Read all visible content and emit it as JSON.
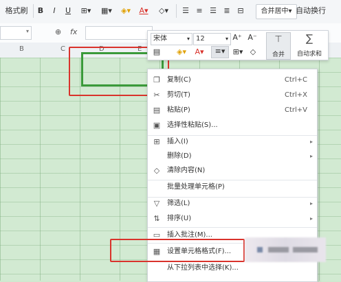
{
  "toolbar": {
    "format_painter": "格式刷",
    "bold": "B",
    "italic": "I",
    "underline": "U",
    "merge_center": "合并居中",
    "wrap_text": "自动换行"
  },
  "formula_bar": {
    "fx": "fx"
  },
  "columns": [
    "B",
    "C",
    "D",
    "E"
  ],
  "mini_toolbar": {
    "font_name": "宋体",
    "font_size": "12",
    "grow_font": "A⁺",
    "shrink_font": "A⁻",
    "merge_label": "合并",
    "autosum_label": "自动求和"
  },
  "context_menu": {
    "items": [
      {
        "label": "复制(C)",
        "shortcut": "Ctrl+C",
        "icon": "copy-icon"
      },
      {
        "label": "剪切(T)",
        "shortcut": "Ctrl+X",
        "icon": "cut-icon"
      },
      {
        "label": "粘贴(P)",
        "shortcut": "Ctrl+V",
        "icon": "paste-icon"
      },
      {
        "label": "选择性粘贴(S)...",
        "shortcut": "",
        "icon": "paste-special-icon"
      },
      {
        "label": "插入(I)",
        "shortcut": "",
        "icon": "insert-icon",
        "submenu": true
      },
      {
        "label": "删除(D)",
        "shortcut": "",
        "icon": "",
        "submenu": true
      },
      {
        "label": "清除内容(N)",
        "shortcut": "",
        "icon": "eraser-icon"
      },
      {
        "label": "批量处理单元格(P)",
        "shortcut": "",
        "icon": ""
      },
      {
        "label": "筛选(L)",
        "shortcut": "",
        "icon": "filter-icon",
        "submenu": true
      },
      {
        "label": "排序(U)",
        "shortcut": "",
        "icon": "sort-icon",
        "submenu": true
      },
      {
        "label": "插入批注(M)...",
        "shortcut": "",
        "icon": "comment-icon"
      },
      {
        "label": "设置单元格格式(F)...",
        "shortcut": "",
        "icon": "format-cells-icon"
      },
      {
        "label": "从下拉列表中选择(K)...",
        "shortcut": "",
        "icon": ""
      }
    ]
  },
  "colors": {
    "selection": "#3a9a3a",
    "highlight": "#d9322b",
    "sheet": "#d2ead2"
  }
}
